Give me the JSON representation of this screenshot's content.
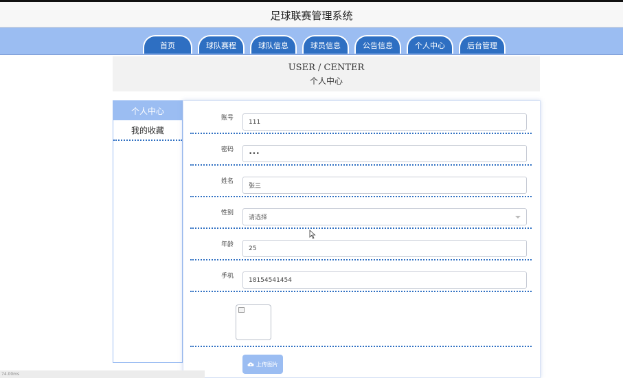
{
  "site": {
    "title": "足球联赛管理系统"
  },
  "nav": {
    "tabs": [
      "首页",
      "球队赛程",
      "球队信息",
      "球员信息",
      "公告信息",
      "个人中心",
      "后台管理"
    ]
  },
  "header": {
    "title_en": "USER / CENTER",
    "title_cn": "个人中心"
  },
  "sidebar": {
    "active": "个人中心",
    "items": [
      "我的收藏"
    ]
  },
  "form": {
    "account": {
      "label": "账号",
      "value": "111"
    },
    "password": {
      "label": "密码",
      "value": "•••"
    },
    "name": {
      "label": "姓名",
      "value": "张三"
    },
    "gender": {
      "label": "性别",
      "placeholder": "请选择"
    },
    "age": {
      "label": "年龄",
      "value": "25"
    },
    "phone": {
      "label": "手机",
      "value": "18154541454"
    },
    "upload_label": "上传图片"
  },
  "status_bar": {
    "text": "74.00ms"
  },
  "colors": {
    "nav_bg": "#9bbdf2",
    "tab_bg": "#2e6fc2",
    "divider": "#2e6fc2"
  },
  "icons": {
    "upload": "cloud-upload-icon",
    "image": "broken-image-icon",
    "cursor": "mouse-cursor-icon"
  }
}
